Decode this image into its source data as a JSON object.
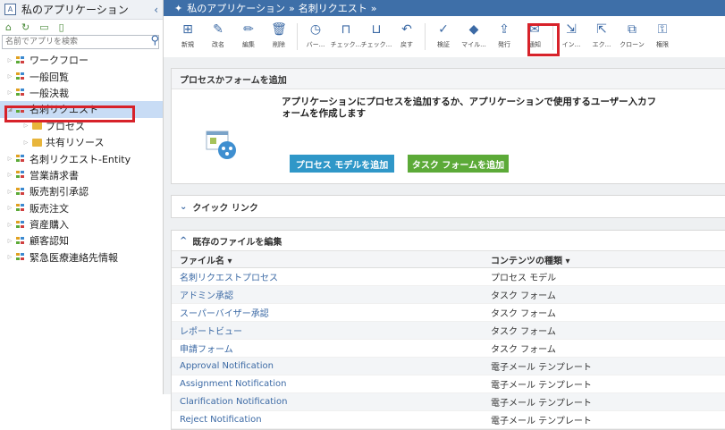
{
  "sidebar": {
    "title": "私のアプリケーション",
    "search_placeholder": "名前でアプリを検索",
    "items": [
      {
        "label": "ワークフロー",
        "level": 1
      },
      {
        "label": "一般回覧",
        "level": 1
      },
      {
        "label": "一般決裁",
        "level": 1
      },
      {
        "label": "名刺リクエスト",
        "level": 1,
        "selected": true
      },
      {
        "label": "プロセス",
        "level": 2
      },
      {
        "label": "共有リソース",
        "level": 2
      },
      {
        "label": "名刺リクエスト-Entity",
        "level": 1
      },
      {
        "label": "営業請求書",
        "level": 1
      },
      {
        "label": "販売割引承認",
        "level": 1
      },
      {
        "label": "販売注文",
        "level": 1
      },
      {
        "label": "資産購入",
        "level": 1
      },
      {
        "label": "顧客認知",
        "level": 1
      },
      {
        "label": "緊急医療連絡先情報",
        "level": 1
      }
    ]
  },
  "breadcrumb": {
    "root": "私のアプリケーション",
    "sep": "»",
    "current": "名刺リクエスト",
    "trail": "»"
  },
  "toolbar": {
    "buttons": [
      {
        "label": "新規",
        "icon": "new-icon"
      },
      {
        "label": "改名",
        "icon": "rename-icon"
      },
      {
        "label": "編集",
        "icon": "edit-icon"
      },
      {
        "label": "削除",
        "icon": "delete-icon"
      },
      {
        "label": "バー...",
        "icon": "version-icon"
      },
      {
        "label": "チェック...",
        "icon": "checkout-icon"
      },
      {
        "label": "チェック...",
        "icon": "checkin-icon"
      },
      {
        "label": "戻す",
        "icon": "revert-icon"
      },
      {
        "label": "検証",
        "icon": "validate-icon"
      },
      {
        "label": "マイル...",
        "icon": "milestone-icon"
      },
      {
        "label": "発行",
        "icon": "publish-icon"
      },
      {
        "label": "通知",
        "icon": "notify-icon"
      },
      {
        "label": "イン...",
        "icon": "import-icon"
      },
      {
        "label": "エク...",
        "icon": "export-icon"
      },
      {
        "label": "クローン",
        "icon": "clone-icon"
      },
      {
        "label": "権限",
        "icon": "permission-icon"
      }
    ]
  },
  "process_panel": {
    "heading": "プロセスかフォームを追加",
    "description": "アプリケーションにプロセスを追加するか、アプリケーションで使用するユーザー入カフォームを作成します",
    "add_process_model": "プロセス モデルを追加",
    "add_task_form": "タスク フォームを追加"
  },
  "quick_links": {
    "heading": "クイック リンク"
  },
  "files": {
    "heading": "既存のファイルを編集",
    "col_name": "ファイル名 ▾",
    "col_type": "コンテンツの種類 ▾",
    "rows": [
      {
        "name": "名刺リクエストプロセス",
        "type": "プロセス モデル"
      },
      {
        "name": "アドミン承認",
        "type": "タスク フォーム"
      },
      {
        "name": "スーパーバイザー承認",
        "type": "タスク フォーム"
      },
      {
        "name": "レポートビュー",
        "type": "タスク フォーム"
      },
      {
        "name": "申請フォーム",
        "type": "タスク フォーム"
      },
      {
        "name": "Approval Notification",
        "type": "電子メール テンプレート"
      },
      {
        "name": "Assignment Notification",
        "type": "電子メール テンプレート"
      },
      {
        "name": "Clarification Notification",
        "type": "電子メール テンプレート"
      },
      {
        "name": "Reject Notification",
        "type": "電子メール テンプレート"
      }
    ]
  },
  "colors": {
    "header_blue": "#3e6fa8",
    "link_blue": "#3c6aa5",
    "green_button": "#5caa38",
    "blue_button": "#2f97c8",
    "highlight_red": "#d7222a"
  }
}
